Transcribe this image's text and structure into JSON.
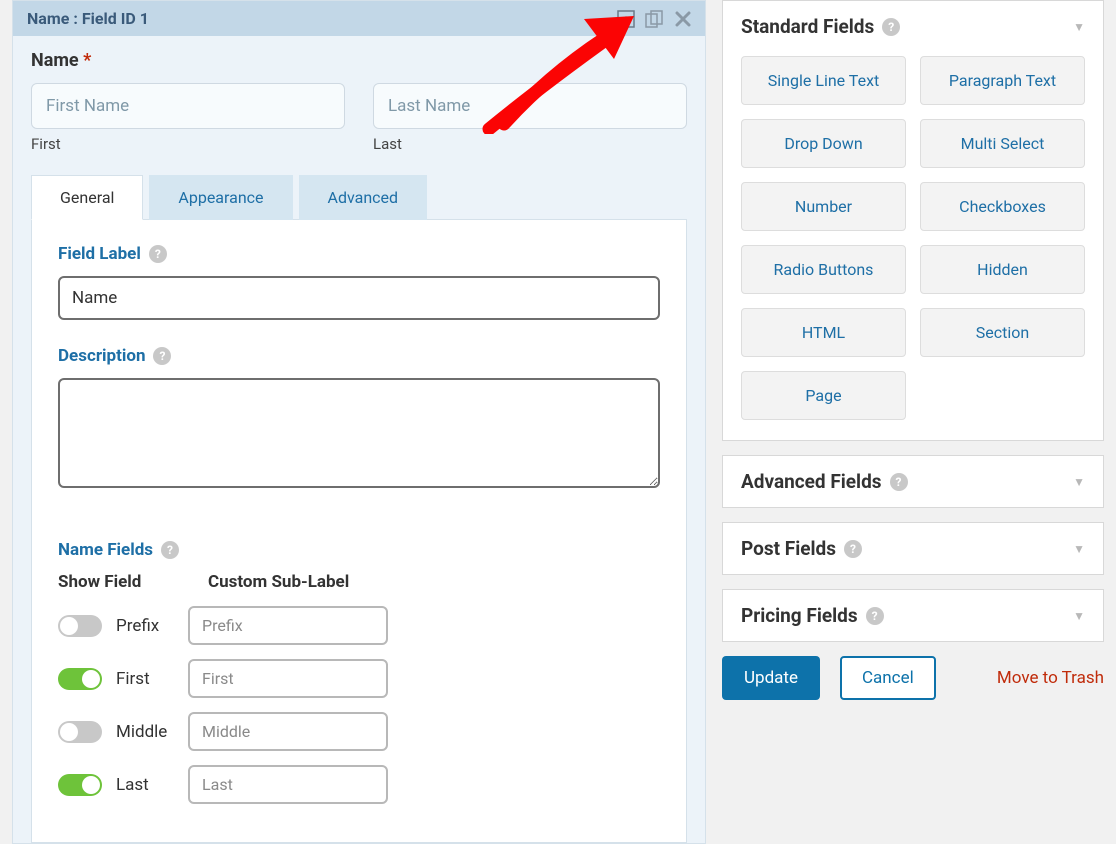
{
  "field": {
    "header_title": "Name : Field ID 1",
    "label": "Name",
    "first_placeholder": "First Name",
    "last_placeholder": "Last Name",
    "first_sub": "First",
    "last_sub": "Last"
  },
  "tabs": [
    "General",
    "Appearance",
    "Advanced"
  ],
  "settings": {
    "field_label_title": "Field Label",
    "field_label_value": "Name",
    "description_title": "Description",
    "description_value": "",
    "name_fields_title": "Name Fields",
    "show_field_heading": "Show Field",
    "sublabel_heading": "Custom Sub-Label",
    "rows": [
      {
        "label": "Prefix",
        "placeholder": "Prefix",
        "on": false
      },
      {
        "label": "First",
        "placeholder": "First",
        "on": true
      },
      {
        "label": "Middle",
        "placeholder": "Middle",
        "on": false
      },
      {
        "label": "Last",
        "placeholder": "Last",
        "on": true
      }
    ]
  },
  "sidebar": {
    "standard_title": "Standard Fields",
    "standard_fields": [
      "Single Line Text",
      "Paragraph Text",
      "Drop Down",
      "Multi Select",
      "Number",
      "Checkboxes",
      "Radio Buttons",
      "Hidden",
      "HTML",
      "Section",
      "Page"
    ],
    "advanced_title": "Advanced Fields",
    "post_title": "Post Fields",
    "pricing_title": "Pricing Fields"
  },
  "actions": {
    "update": "Update",
    "cancel": "Cancel",
    "trash": "Move to Trash"
  }
}
